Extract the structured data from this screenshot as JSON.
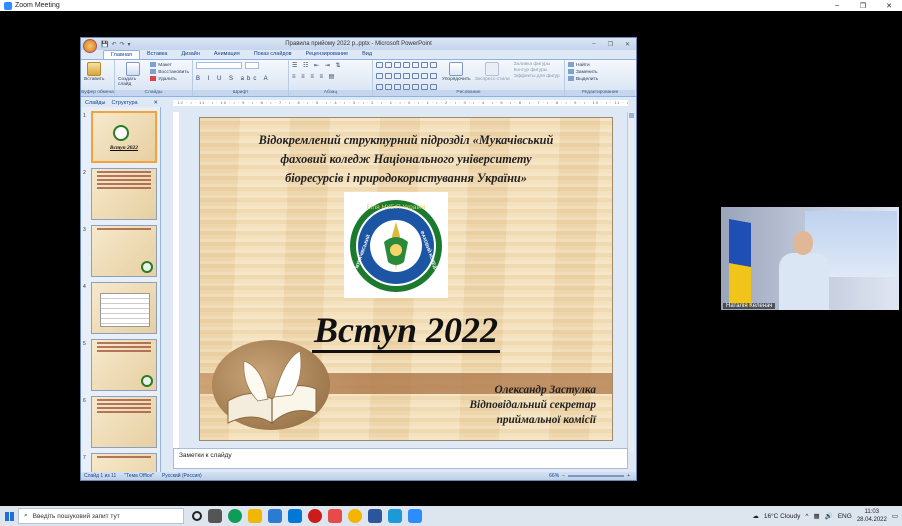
{
  "zoom": {
    "window_title": "Zoom Meeting",
    "controls": [
      "–",
      "❐",
      "✕"
    ]
  },
  "ppt": {
    "title": "Правила прийому 2022 р..pptx - Microsoft PowerPoint",
    "qat": [
      "💾",
      "↶",
      "↷",
      "▾"
    ],
    "window_controls": [
      "–",
      "❐",
      "✕"
    ],
    "tabs": [
      "Главная",
      "Вставка",
      "Дизайн",
      "Анимация",
      "Показ слайдов",
      "Рецензирование",
      "Вид"
    ],
    "active_tab": 0,
    "ribbon": {
      "clipboard": {
        "paste": "Вставить",
        "label": "Буфер обмена"
      },
      "slides": {
        "create": "Создать слайд",
        "layout": "Макет",
        "restore": "Восстановить",
        "delete": "Удалить",
        "label": "Слайды"
      },
      "font": {
        "label": "Шрифт"
      },
      "paragraph": {
        "label": "Абзац"
      },
      "drawing": {
        "arrange": "Упорядочить",
        "quick_styles": "Экспресс-стили",
        "fill": "Заливка фигуры",
        "outline": "Контур фигуры",
        "effects": "Эффекты для фигур",
        "label": "Рисование"
      },
      "editing": {
        "find": "Найти",
        "replace": "Заменить",
        "select": "Выделить",
        "label": "Редактирование"
      }
    },
    "pane_tabs": [
      "Слайды",
      "Структура"
    ],
    "thumb_numbers": [
      "1",
      "2",
      "3",
      "4",
      "5",
      "6",
      "7"
    ],
    "thumb1_title": "Вступ 2022",
    "ruler_text": "· 12 · ı · 11 · ı · 10 · ı · 9 · ı · 8 · ı · 7 · ı · 6 · ı · 5 · ı · 4 · ı · 3 · ı · 2 · ı · 1 · ı · 0 · ı · 1 · ı · 2 · ı · 3 · ı · 4 · ı · 5 · ı · 6 · ı · 7 · ı · 8 · ı · 9 · ı · 10 · ı · 11 · ı · 12 ·",
    "slide": {
      "header_line1": "Відокремлений структурний підрозділ «Мукачівський",
      "header_line2": "фаховий коледж Національного університету",
      "header_line3": "біоресурсів і природокористування України»",
      "logo_top": "Біля НУБіП України",
      "logo_left": "МУКАЧІВСЬКИЙ",
      "logo_right": "ФАХОВИЙ КОЛЕДЖ",
      "title": "Вступ 2022",
      "author_name": "Олександр Застулка",
      "author_role1": "Відповідальний секретар",
      "author_role2": "приймальної комісії"
    },
    "notes_placeholder": "Заметки к слайду",
    "status": {
      "slide_info": "Слайд 1 из 11",
      "theme": "\"Тема Office\"",
      "language": "Русский (Россия)",
      "zoom": "66%"
    }
  },
  "cam": {
    "participant": "Наталія Келенач"
  },
  "taskbar": {
    "search_placeholder": "Введіть пошуковий запит тут",
    "weather": "16°C  Cloudy",
    "lang": "ENG",
    "time": "11:03",
    "date": "28.04.2022",
    "app_colors": [
      "#1e6fd9",
      "#f2b705",
      "#0078d7",
      "#2c7bd3",
      "#cc1b1b",
      "#0e9d58",
      "#f4511e",
      "#2b579a",
      "#1a9bd7",
      "#2d8cff"
    ]
  }
}
